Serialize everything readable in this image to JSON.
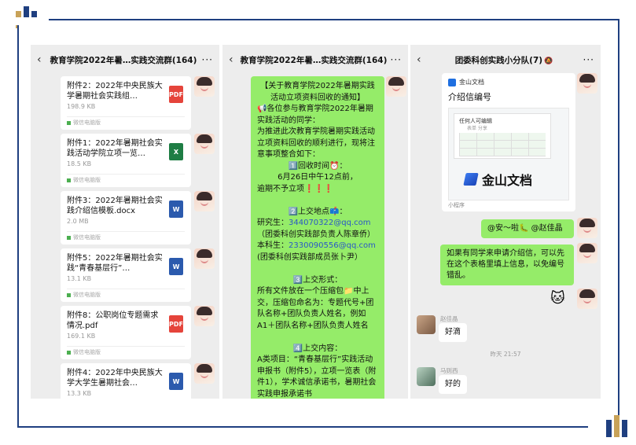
{
  "panel1": {
    "title": "教育学院2022年暑…实践交流群(164)",
    "back_icon": "chevron-left-icon",
    "more_icon": "more-dots-icon",
    "files": [
      {
        "name": "附件2：2022年中央民族大学暑期社会实践组…",
        "size": "198.9 KB",
        "source": "微信电脑版",
        "type": "PDF"
      },
      {
        "name": "附件1：2022年暑期社会实践活动学院立项一览…",
        "size": "18.5 KB",
        "source": "微信电脑版",
        "type": "X"
      },
      {
        "name": "附件3：2022年暑期社会实践介绍信模板.docx",
        "size": "2.0 MB",
        "source": "微信电脑版",
        "type": "W"
      },
      {
        "name": "附件5：2022年暑期社会实践“青春基层行”…",
        "size": "13.1 KB",
        "source": "微信电脑版",
        "type": "W"
      },
      {
        "name": "附件8：公职岗位专题需求情况.pdf",
        "size": "169.1 KB",
        "source": "微信电脑版",
        "type": "PDF"
      },
      {
        "name": "附件4：2022年中央民族大学大学生暑期社会…",
        "size": "13.3 KB",
        "source": "",
        "type": "W"
      }
    ]
  },
  "panel2": {
    "title": "教育学院2022年暑…实践交流群(164)",
    "notice": {
      "l1": "【关于教育学院2022年暑期实践活动立项资料回收的通知】",
      "l2": "📢各位参与教育学院2022年暑期实践活动的同学：",
      "l3": "为推进此次教育学院暑期实践活动立项资料回收的顺利进行，现将注意事项整合如下：",
      "s1": "1️⃣回收时间⏰：",
      "s1a": "6月26日中午12点前，",
      "s1b": "逾期不予立项",
      "s1c": "❗❗❗",
      "s2": "2️⃣上交地点📫：",
      "s2a_label": "研究生：",
      "s2a_mail": "344070322@qq.com",
      "s2a_note": "（团委科创实践部负责人陈章侨）",
      "s2b_label": "本科生：",
      "s2b_mail": "2330090556@qq.com",
      "s2b_note": "(团委科创实践部成员张卜尹）",
      "s3": "3️⃣上交形式：",
      "s3a": "所有文件放在一个压缩包📁中上交，压缩包命名为：专题代号+团队名称+团队负责人姓名，例如 A1＋团队名称+团队负责人姓名",
      "s4": "4️⃣上交内容：",
      "s4a": "A类项目：“青春基层行”实践活动申报书（附件5），立项一览表（附件1），学术诚信承诺书，暑期社会实践申报承诺书"
    }
  },
  "panel3": {
    "title": "团委科创实践小分队(7)",
    "mute_icon": "mute-bell-icon",
    "card": {
      "brand": "金山文档",
      "title": "介绍信编号",
      "sheet_tag": "任何人可编辑",
      "sheet_sub": "表单 分享",
      "logo": "金山文档",
      "footer": "小程序"
    },
    "mention": "@安～啦🐛 @赵佳晶",
    "msg2": "如果有同学来申请介绍信，可以先在这个表格里填上信息，以免编号错乱。",
    "reply1_nick": "赵佳晶",
    "reply1": "好滴",
    "time": "昨天 21:57",
    "reply2_nick": "马则西",
    "reply2": "好的"
  }
}
